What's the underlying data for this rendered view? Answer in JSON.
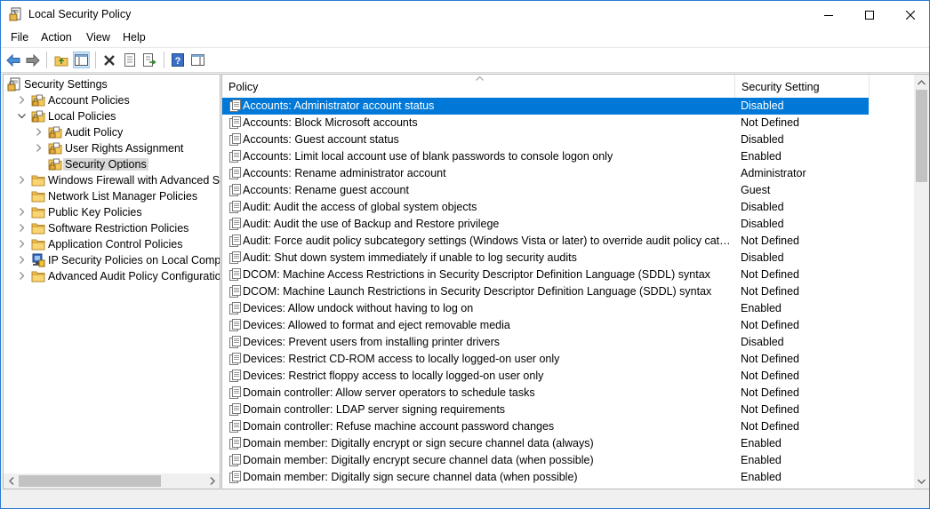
{
  "window": {
    "title": "Local Security Policy"
  },
  "menu": [
    "File",
    "Action",
    "View",
    "Help"
  ],
  "tree": [
    {
      "label": "Security Settings",
      "level": 0,
      "expander": "none",
      "icon": "security-settings",
      "selected": false
    },
    {
      "label": "Account Policies",
      "level": 1,
      "expander": "collapsed",
      "icon": "folder-lock",
      "selected": false
    },
    {
      "label": "Local Policies",
      "level": 1,
      "expander": "expanded",
      "icon": "folder-lock",
      "selected": false
    },
    {
      "label": "Audit Policy",
      "level": 2,
      "expander": "collapsed",
      "icon": "folder-lock",
      "selected": false
    },
    {
      "label": "User Rights Assignment",
      "level": 2,
      "expander": "collapsed",
      "icon": "folder-lock",
      "selected": false
    },
    {
      "label": "Security Options",
      "level": 2,
      "expander": "none",
      "icon": "folder-lock",
      "selected": true
    },
    {
      "label": "Windows Firewall with Advanced Secu",
      "level": 1,
      "expander": "collapsed",
      "icon": "folder",
      "selected": false
    },
    {
      "label": "Network List Manager Policies",
      "level": 1,
      "expander": "none",
      "icon": "folder",
      "selected": false
    },
    {
      "label": "Public Key Policies",
      "level": 1,
      "expander": "collapsed",
      "icon": "folder",
      "selected": false
    },
    {
      "label": "Software Restriction Policies",
      "level": 1,
      "expander": "collapsed",
      "icon": "folder",
      "selected": false
    },
    {
      "label": "Application Control Policies",
      "level": 1,
      "expander": "collapsed",
      "icon": "folder",
      "selected": false
    },
    {
      "label": "IP Security Policies on Local Compute",
      "level": 1,
      "expander": "collapsed",
      "icon": "ip-security",
      "selected": false
    },
    {
      "label": "Advanced Audit Policy Configuration",
      "level": 1,
      "expander": "collapsed",
      "icon": "folder",
      "selected": false
    }
  ],
  "list": {
    "columns": {
      "policy": "Policy",
      "setting": "Security Setting"
    },
    "rows": [
      {
        "policy": "Accounts: Administrator account status",
        "setting": "Disabled",
        "selected": true
      },
      {
        "policy": "Accounts: Block Microsoft accounts",
        "setting": "Not Defined"
      },
      {
        "policy": "Accounts: Guest account status",
        "setting": "Disabled"
      },
      {
        "policy": "Accounts: Limit local account use of blank passwords to console logon only",
        "setting": "Enabled"
      },
      {
        "policy": "Accounts: Rename administrator account",
        "setting": "Administrator"
      },
      {
        "policy": "Accounts: Rename guest account",
        "setting": "Guest"
      },
      {
        "policy": "Audit: Audit the access of global system objects",
        "setting": "Disabled"
      },
      {
        "policy": "Audit: Audit the use of Backup and Restore privilege",
        "setting": "Disabled"
      },
      {
        "policy": "Audit: Force audit policy subcategory settings (Windows Vista or later) to override audit policy category...",
        "setting": "Not Defined"
      },
      {
        "policy": "Audit: Shut down system immediately if unable to log security audits",
        "setting": "Disabled"
      },
      {
        "policy": "DCOM: Machine Access Restrictions in Security Descriptor Definition Language (SDDL) syntax",
        "setting": "Not Defined"
      },
      {
        "policy": "DCOM: Machine Launch Restrictions in Security Descriptor Definition Language (SDDL) syntax",
        "setting": "Not Defined"
      },
      {
        "policy": "Devices: Allow undock without having to log on",
        "setting": "Enabled"
      },
      {
        "policy": "Devices: Allowed to format and eject removable media",
        "setting": "Not Defined"
      },
      {
        "policy": "Devices: Prevent users from installing printer drivers",
        "setting": "Disabled"
      },
      {
        "policy": "Devices: Restrict CD-ROM access to locally logged-on user only",
        "setting": "Not Defined"
      },
      {
        "policy": "Devices: Restrict floppy access to locally logged-on user only",
        "setting": "Not Defined"
      },
      {
        "policy": "Domain controller: Allow server operators to schedule tasks",
        "setting": "Not Defined"
      },
      {
        "policy": "Domain controller: LDAP server signing requirements",
        "setting": "Not Defined"
      },
      {
        "policy": "Domain controller: Refuse machine account password changes",
        "setting": "Not Defined"
      },
      {
        "policy": "Domain member: Digitally encrypt or sign secure channel data (always)",
        "setting": "Enabled"
      },
      {
        "policy": "Domain member: Digitally encrypt secure channel data (when possible)",
        "setting": "Enabled"
      },
      {
        "policy": "Domain member: Digitally sign secure channel data (when possible)",
        "setting": "Enabled"
      }
    ]
  },
  "colors": {
    "selection": "#0078d7",
    "tree_selection": "#d9d9d9",
    "window_border": "#2b79d0",
    "folder": "#f4c85a"
  },
  "icons": [
    "app-icon",
    "minimize-icon",
    "maximize-icon",
    "close-icon",
    "back-arrow-icon",
    "forward-arrow-icon",
    "up-folder-icon",
    "show-hide-tree-icon",
    "delete-icon",
    "properties-icon",
    "export-list-icon",
    "help-icon",
    "action-pane-icon"
  ]
}
